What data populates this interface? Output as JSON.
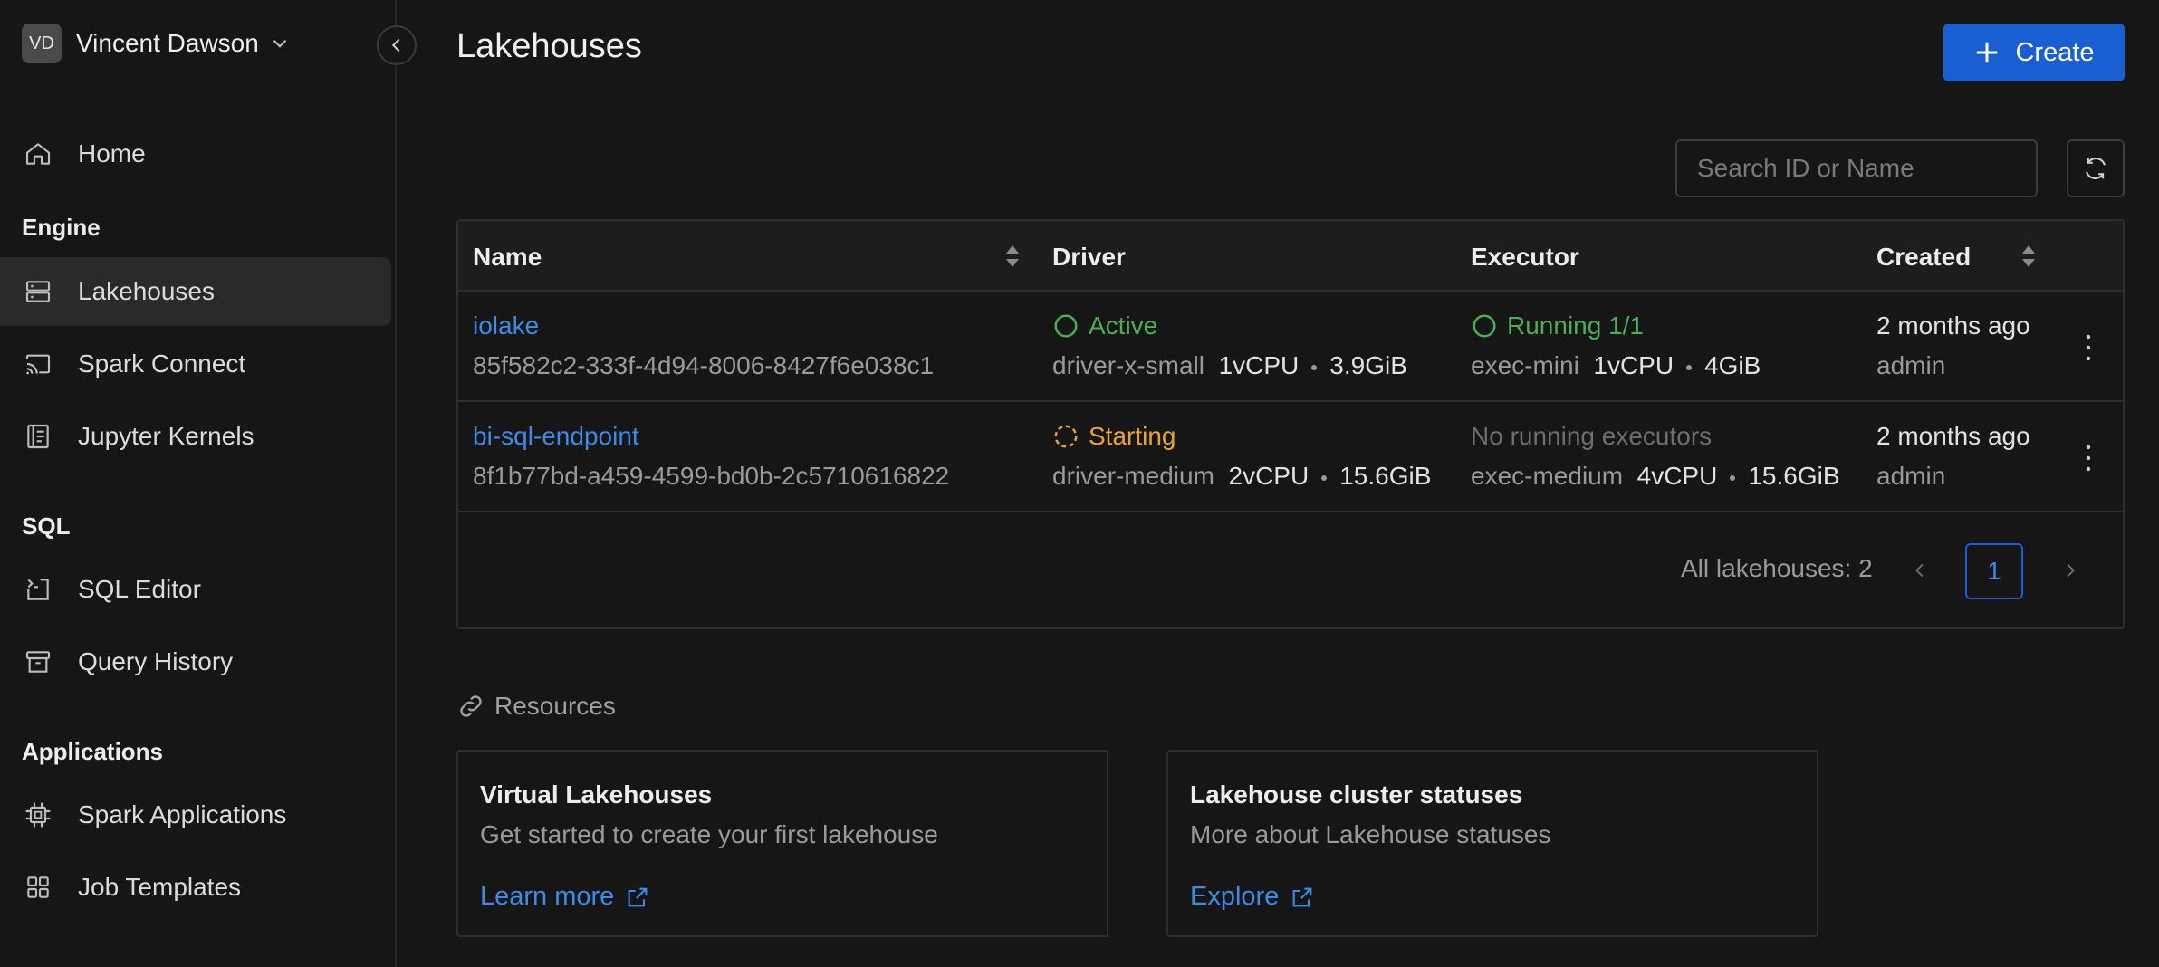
{
  "user": {
    "initials": "VD",
    "name": "Vincent Dawson"
  },
  "nav": {
    "home": "Home",
    "sections": {
      "engine": "Engine",
      "sql": "SQL",
      "applications": "Applications"
    },
    "lakehouses": "Lakehouses",
    "spark_connect": "Spark Connect",
    "jupyter_kernels": "Jupyter Kernels",
    "sql_editor": "SQL Editor",
    "query_history": "Query History",
    "spark_applications": "Spark Applications",
    "job_templates": "Job Templates"
  },
  "page": {
    "title": "Lakehouses",
    "create_label": "Create",
    "search_placeholder": "Search ID or Name"
  },
  "table": {
    "headers": {
      "name": "Name",
      "driver": "Driver",
      "executor": "Executor",
      "created": "Created"
    },
    "rows": [
      {
        "name": "iolake",
        "id": "85f582c2-333f-4d94-8006-8427f6e038c1",
        "driver_status": "Active",
        "driver_type": "driver-x-small",
        "driver_cpu": "1vCPU",
        "driver_mem": "3.9GiB",
        "executor_status": "Running 1/1",
        "executor_type": "exec-mini",
        "executor_cpu": "1vCPU",
        "executor_mem": "4GiB",
        "created": "2 months ago",
        "owner": "admin"
      },
      {
        "name": "bi-sql-endpoint",
        "id": "8f1b77bd-a459-4599-bd0b-2c5710616822",
        "driver_status": "Starting",
        "driver_type": "driver-medium",
        "driver_cpu": "2vCPU",
        "driver_mem": "15.6GiB",
        "executor_status": "No running executors",
        "executor_type": "exec-medium",
        "executor_cpu": "4vCPU",
        "executor_mem": "15.6GiB",
        "created": "2 months ago",
        "owner": "admin"
      }
    ],
    "total_label": "All lakehouses: 2",
    "current_page": "1"
  },
  "resources": {
    "title": "Resources",
    "cards": [
      {
        "title": "Virtual Lakehouses",
        "desc": "Get started to create your first lakehouse",
        "link": "Learn more"
      },
      {
        "title": "Lakehouse cluster statuses",
        "desc": "More about Lakehouse statuses",
        "link": "Explore"
      }
    ]
  },
  "colors": {
    "accent": "#1a5fd1",
    "link": "#3d8ae8",
    "active": "#4cae55",
    "starting": "#e9a23b"
  }
}
